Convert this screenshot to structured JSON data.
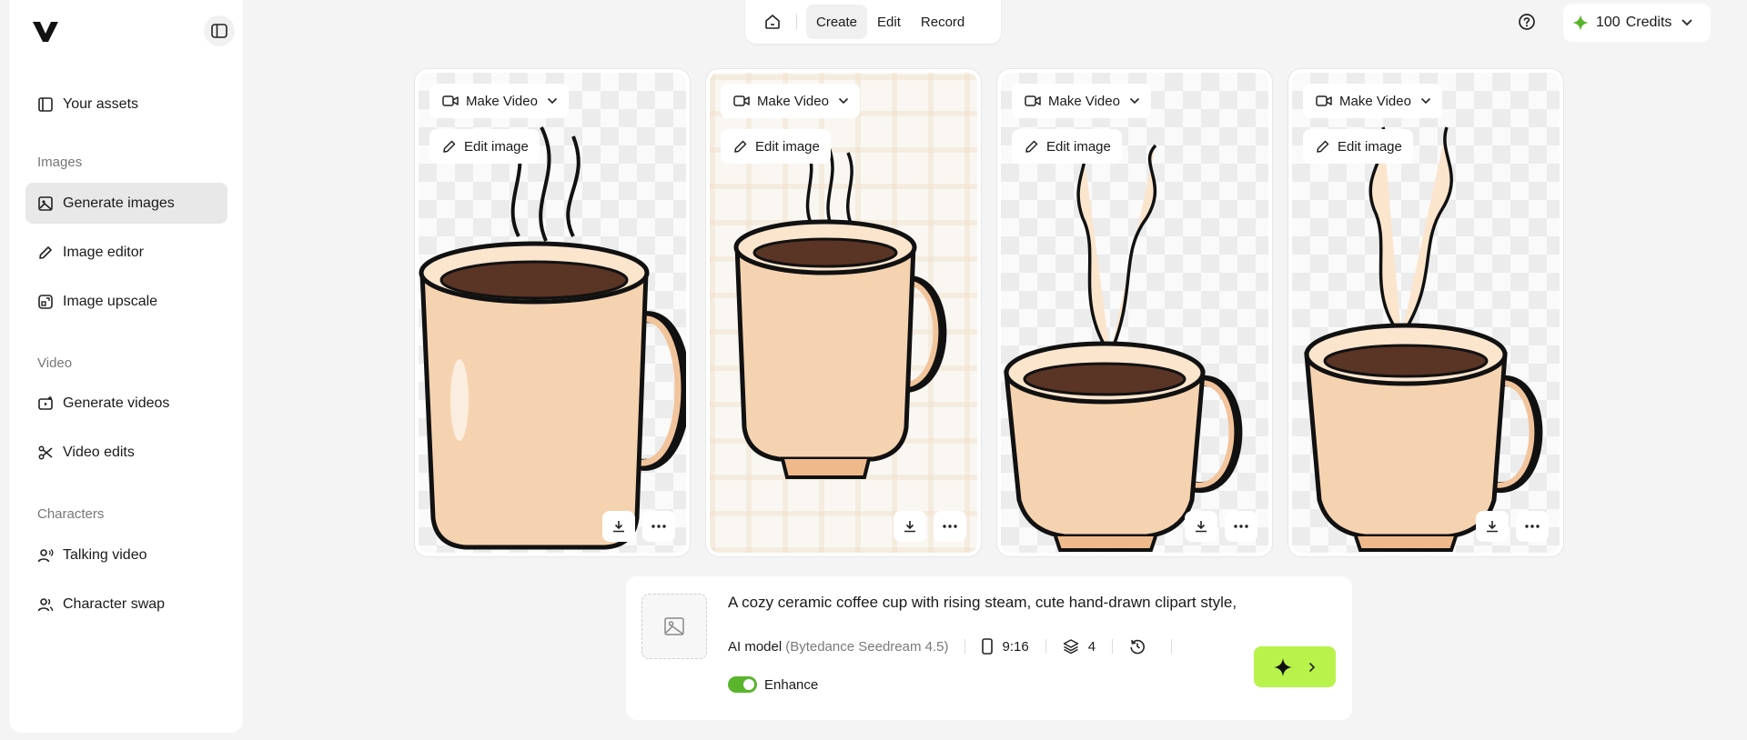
{
  "sidebar": {
    "items": [
      {
        "label": "Your assets"
      },
      {
        "label": "Generate images"
      },
      {
        "label": "Image editor"
      },
      {
        "label": "Image upscale"
      },
      {
        "label": "Generate videos"
      },
      {
        "label": "Video edits"
      },
      {
        "label": "Talking video"
      },
      {
        "label": "Character swap"
      }
    ],
    "sections": {
      "images": "Images",
      "video": "Video",
      "characters": "Characters"
    }
  },
  "topnav": {
    "tabs": [
      "Create",
      "Edit",
      "Record"
    ],
    "active": "Create"
  },
  "credits": {
    "amount": "100",
    "label": "Credits",
    "accent": "#5ab52d"
  },
  "cards": {
    "make_video": "Make Video",
    "edit_image": "Edit image"
  },
  "prompt": {
    "text": "A cozy ceramic coffee cup with rising steam, cute hand-drawn clipart style,",
    "model_label": "AI model",
    "model_name": "(Bytedance Seedream 4.5)",
    "aspect": "9:16",
    "count": "4",
    "enhance_label": "Enhance",
    "enhance_on": true
  },
  "colors": {
    "go_button": "#b9f24a",
    "active_nav": "#e8e8e8"
  }
}
